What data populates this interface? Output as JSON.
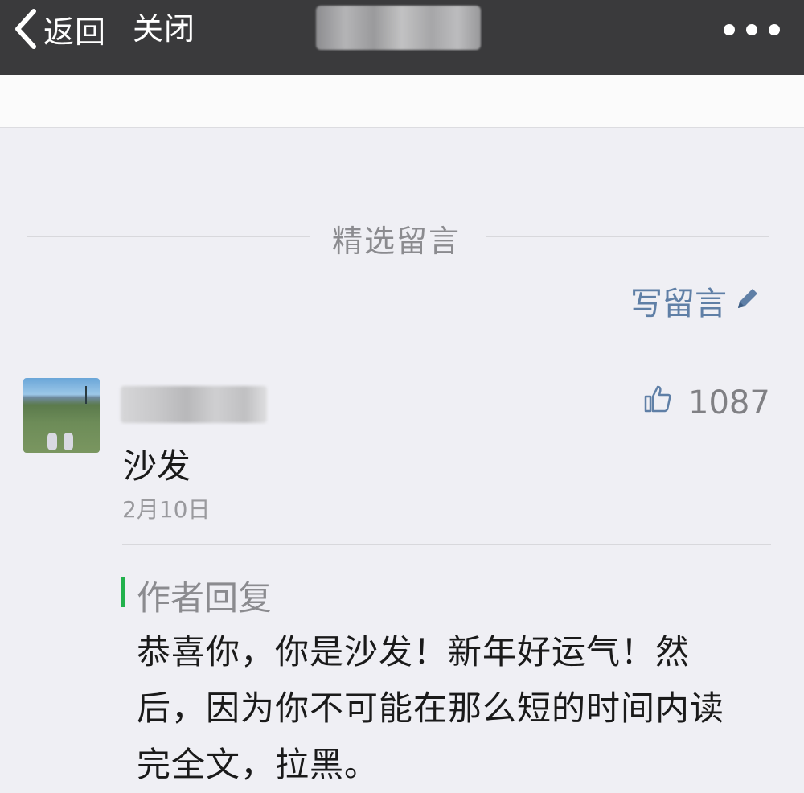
{
  "nav": {
    "back_label": "返回",
    "close_label": "关闭"
  },
  "comments_section": {
    "title": "精选留言",
    "write_label": "写留言"
  },
  "comment": {
    "likes": "1087",
    "text": "沙发",
    "date": "2月10日",
    "reply": {
      "title": "作者回复",
      "lines": [
        "恭喜你，你是沙发！新年好运气！然",
        "后，因为你不可能在那么短的时间内读",
        "完全文，拉黑。"
      ]
    }
  },
  "colors": {
    "topbar": "#3a3a3c",
    "background": "#efeff4",
    "link": "#5f7fa6",
    "reply_accent": "#22b14c"
  }
}
